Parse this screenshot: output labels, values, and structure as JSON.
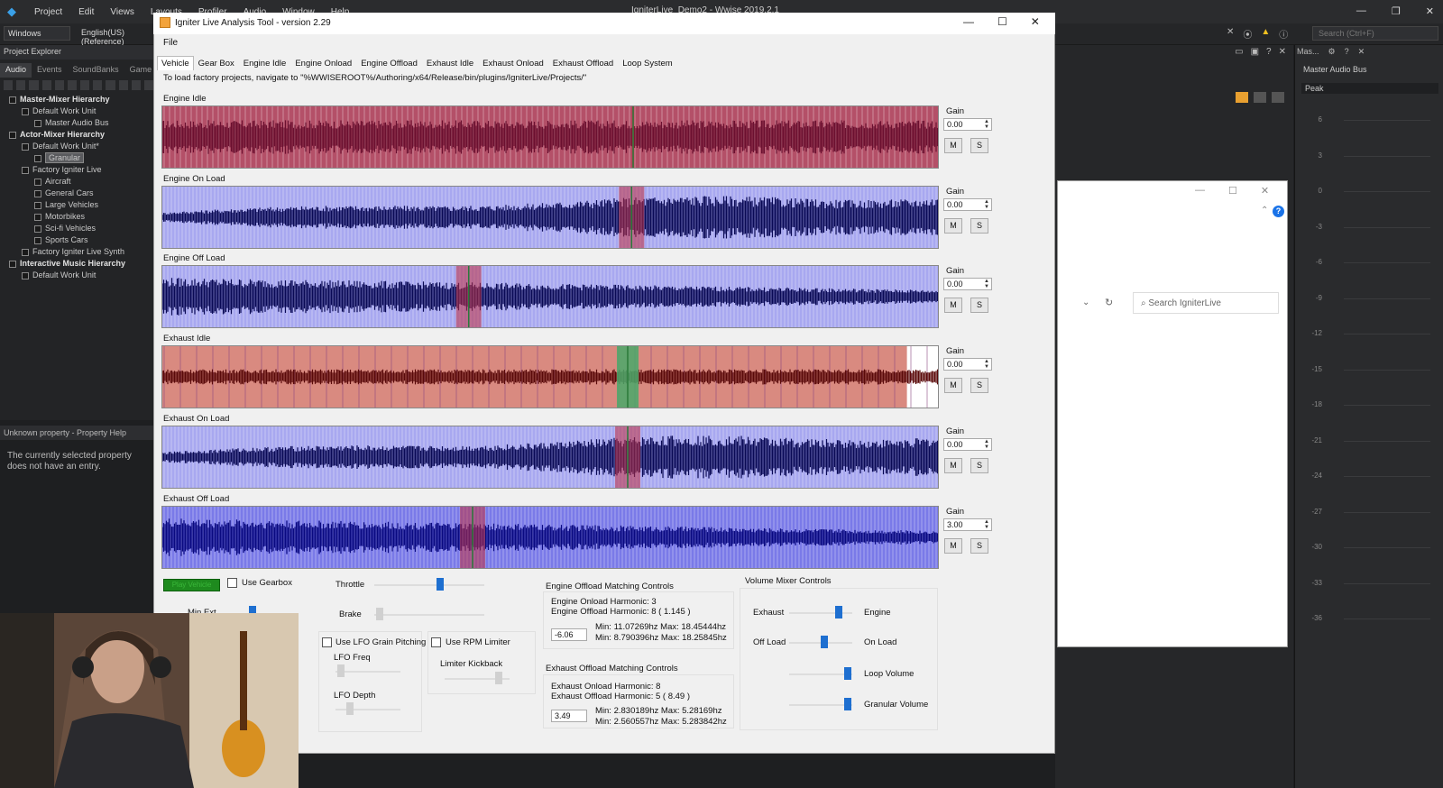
{
  "wwise": {
    "menu": [
      "Project",
      "Edit",
      "Views",
      "Layouts",
      "Profiler",
      "Audio",
      "Window",
      "Help"
    ],
    "title": "IgniterLive_Demo2 - Wwise 2019.2.1",
    "layout": "Windows",
    "language": "English(US) (Reference)",
    "search_placeholder": "Search (Ctrl+F)",
    "project_explorer_title": "Project Explorer",
    "tabs": [
      "Audio",
      "Events",
      "SoundBanks",
      "Game"
    ],
    "tree": [
      {
        "label": "Master-Mixer Hierarchy",
        "indent": 0,
        "bold": true
      },
      {
        "label": "Default Work Unit",
        "indent": 1,
        "bold": false
      },
      {
        "label": "Master Audio Bus",
        "indent": 2,
        "bold": false
      },
      {
        "label": "Actor-Mixer Hierarchy",
        "indent": 0,
        "bold": true
      },
      {
        "label": "Default Work Unit*",
        "indent": 1,
        "bold": false
      },
      {
        "label": "Granular",
        "indent": 2,
        "bold": false,
        "selected": true
      },
      {
        "label": "Factory Igniter Live",
        "indent": 1,
        "bold": false
      },
      {
        "label": "Aircraft",
        "indent": 2,
        "bold": false
      },
      {
        "label": "General Cars",
        "indent": 2,
        "bold": false
      },
      {
        "label": "Large Vehicles",
        "indent": 2,
        "bold": false
      },
      {
        "label": "Motorbikes",
        "indent": 2,
        "bold": false
      },
      {
        "label": "Sci-fi Vehicles",
        "indent": 2,
        "bold": false
      },
      {
        "label": "Sports Cars",
        "indent": 2,
        "bold": false
      },
      {
        "label": "Factory Igniter Live Synth",
        "indent": 1,
        "bold": false
      },
      {
        "label": "Interactive Music Hierarchy",
        "indent": 0,
        "bold": true
      },
      {
        "label": "Default Work Unit",
        "indent": 1,
        "bold": false
      }
    ],
    "property_help_title": "Unknown property - Property Help",
    "property_help_text": "The currently selected property does not have an entry.",
    "meter_title": "Mas...",
    "meter_bus": "Master Audio Bus",
    "meter_mode": "Peak",
    "meter_scale": [
      "6",
      "3",
      "0",
      "-3",
      "-6",
      "-9",
      "-12",
      "-15",
      "-18",
      "-21",
      "-24",
      "-27",
      "-30",
      "-33",
      "-36"
    ],
    "explorer_search_placeholder": "Search IgniterLive"
  },
  "igniter": {
    "title": "Igniter Live Analysis Tool - version 2.29",
    "menu_file": "File",
    "tabs": [
      "Vehicle",
      "Gear Box",
      "Engine Idle",
      "Engine Onload",
      "Engine Offload",
      "Exhaust Idle",
      "Exhaust Onload",
      "Exhaust Offload",
      "Loop System"
    ],
    "active_tab": "Vehicle",
    "path_hint": "To load factory projects, navigate to \"%WWISEROOT%/Authoring/x64/Release/bin/plugins/IgniterLive/Projects/\"",
    "gain_label": "Gain",
    "mute_label": "M",
    "solo_label": "S",
    "tracks": [
      {
        "name": "Engine Idle",
        "gain": "0.00",
        "bg": "#b45068",
        "wave": "#6b1030",
        "style": "idle"
      },
      {
        "name": "Engine On Load",
        "gain": "0.00",
        "bg": "#a8a8f0",
        "wave": "#0a0a55",
        "style": "onload"
      },
      {
        "name": "Engine Off Load",
        "gain": "0.00",
        "bg": "#a8a8f0",
        "wave": "#0a0a55",
        "style": "offload"
      },
      {
        "name": "Exhaust Idle",
        "gain": "0.00",
        "bg": "#d98a80",
        "wave": "#5a0a0a",
        "style": "exidle"
      },
      {
        "name": "Exhaust On Load",
        "gain": "0.00",
        "bg": "#a8a8f0",
        "wave": "#0a0a55",
        "style": "onload"
      },
      {
        "name": "Exhaust Off Load",
        "gain": "3.00",
        "bg": "#7a7ae8",
        "wave": "#0a0a80",
        "style": "offload"
      }
    ],
    "controls": {
      "play_button": "Play Vehicle",
      "use_gearbox": "Use Gearbox",
      "throttle": "Throttle",
      "brake": "Brake",
      "min_rpm_label": "Min Ext",
      "use_lfo": "Use LFO Grain Pitching",
      "lfo_freq": "LFO Freq",
      "lfo_depth": "LFO Depth",
      "use_rpm_limiter": "Use RPM Limiter",
      "limiter_kickback": "Limiter Kickback",
      "engine_offload_title": "Engine Offload Matching Controls",
      "engine_onload_harmonic": "Engine Onload Harmonic: 3",
      "engine_offload_harmonic": "Engine Offload Harmonic: 8 ( 1.145 )",
      "engine_value": "-6.06",
      "engine_minmax_1": "Min: 11.07269hz Max: 18.45444hz",
      "engine_minmax_2": "Min: 8.790396hz Max: 18.25845hz",
      "exhaust_offload_title": "Exhaust Offload Matching Controls",
      "exhaust_onload_harmonic": "Exhaust Onload Harmonic: 8",
      "exhaust_offload_harmonic": "Exhaust Offload Harmonic: 5 ( 8.49 )",
      "exhaust_value": "3.49",
      "exhaust_minmax_1": "Min: 2.830189hz Max: 5.28169hz",
      "exhaust_minmax_2": "Min: 2.560557hz Max: 5.283842hz",
      "volume_mixer_title": "Volume Mixer Controls",
      "exhaust": "Exhaust",
      "engine": "Engine",
      "off_load": "Off Load",
      "on_load": "On Load",
      "loop_volume": "Loop Volume",
      "granular_volume": "Granular Volume",
      "throttle_level": 0.6,
      "brake_level": 0.05
    }
  },
  "colors": {
    "accent_blue": "#1e6fd0",
    "play_green": "#1e8a1e",
    "warning": "#f0c020"
  }
}
